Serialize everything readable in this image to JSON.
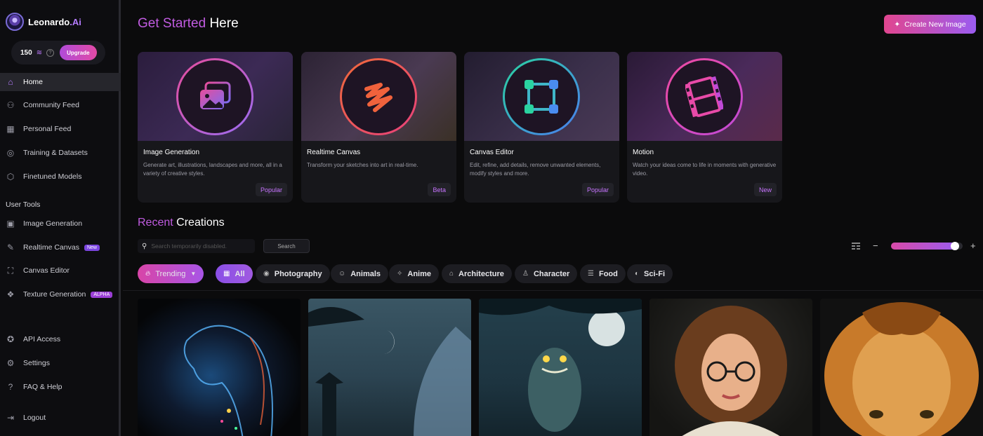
{
  "app": {
    "name": "Leonardo",
    "name_suffix": ".Ai",
    "credits": "150",
    "upgrade_label": "Upgrade"
  },
  "sidebar": {
    "items": [
      {
        "label": "Home",
        "icon": "home-icon",
        "active": true
      },
      {
        "label": "Community Feed",
        "icon": "people-icon"
      },
      {
        "label": "Personal Feed",
        "icon": "grid-icon"
      },
      {
        "label": "Training & Datasets",
        "icon": "training-icon"
      },
      {
        "label": "Finetuned Models",
        "icon": "cube-icon"
      }
    ],
    "user_tools_label": "User Tools",
    "tools": [
      {
        "label": "Image Generation",
        "icon": "image-icon"
      },
      {
        "label": "Realtime Canvas",
        "icon": "brush-icon",
        "badge": "New"
      },
      {
        "label": "Canvas Editor",
        "icon": "crop-icon"
      },
      {
        "label": "Texture Generation",
        "icon": "texture-icon",
        "badge": "ALPHA"
      }
    ],
    "bottom": [
      {
        "label": "API Access",
        "icon": "compass-icon"
      },
      {
        "label": "Settings",
        "icon": "gear-icon"
      },
      {
        "label": "FAQ & Help",
        "icon": "help-icon"
      },
      {
        "label": "Logout",
        "icon": "logout-icon"
      }
    ]
  },
  "header": {
    "title_accent": "Get Started",
    "title_rest": "Here",
    "create_button": "Create New Image"
  },
  "cards": [
    {
      "title": "Image Generation",
      "desc": "Generate art, illustrations, landscapes and more, all in a variety of creative styles.",
      "tag": "Popular",
      "icon": "image-stack-icon"
    },
    {
      "title": "Realtime Canvas",
      "desc": "Transform your sketches into art in real-time.",
      "tag": "Beta",
      "icon": "scribble-icon"
    },
    {
      "title": "Canvas Editor",
      "desc": "Edit, refine, add details, remove unwanted elements, modify styles and more.",
      "tag": "Popular",
      "icon": "transform-icon"
    },
    {
      "title": "Motion",
      "desc": "Watch your ideas come to life in moments with generative video.",
      "tag": "New",
      "icon": "film-icon"
    }
  ],
  "recent": {
    "title_accent": "Recent",
    "title_rest": "Creations",
    "search_placeholder": "Search temporarily disabled.",
    "search_button": "Search",
    "zoom_level": 0.94
  },
  "filters": [
    {
      "label": "Trending",
      "icon": "flame-icon",
      "dropdown": true
    },
    {
      "label": "All",
      "icon": "grid-icon"
    },
    {
      "label": "Photography",
      "icon": "camera-icon"
    },
    {
      "label": "Animals",
      "icon": "cat-icon"
    },
    {
      "label": "Anime",
      "icon": "sparkle-icon"
    },
    {
      "label": "Architecture",
      "icon": "building-icon"
    },
    {
      "label": "Character",
      "icon": "person-icon"
    },
    {
      "label": "Food",
      "icon": "burger-icon"
    },
    {
      "label": "Sci-Fi",
      "icon": "helmet-icon"
    }
  ],
  "gallery": [
    {
      "subject": "neon-girl"
    },
    {
      "subject": "moonlit-wolf"
    },
    {
      "subject": "forest-monster"
    },
    {
      "subject": "woman-glasses"
    },
    {
      "subject": "lion"
    }
  ]
}
